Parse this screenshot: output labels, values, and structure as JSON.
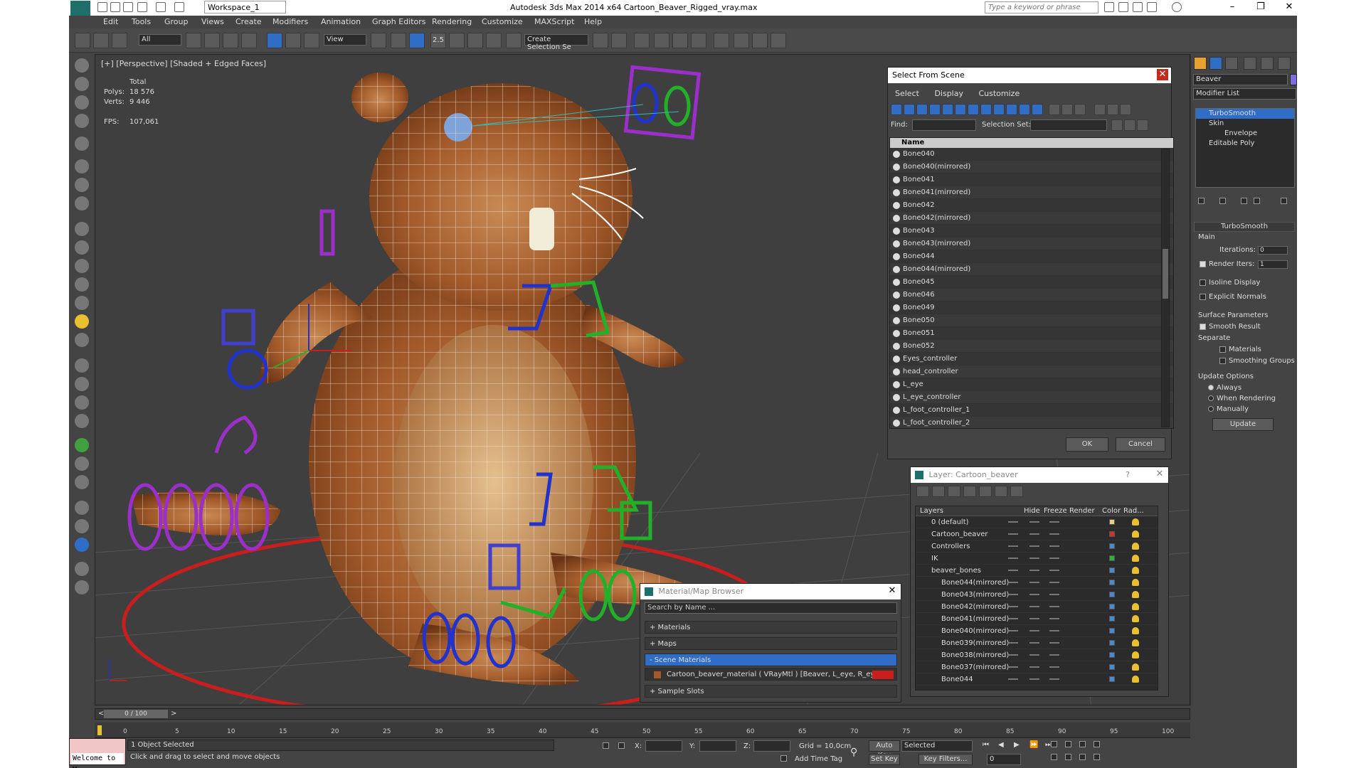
{
  "window": {
    "title": "Autodesk 3ds Max  2014 x64     Cartoon_Beaver_Rigged_vray.max",
    "workspace": "Workspace_1",
    "search_placeholder": "Type a keyword or phrase"
  },
  "menu": [
    "Edit",
    "Tools",
    "Group",
    "Views",
    "Create",
    "Modifiers",
    "Animation",
    "Graph Editors",
    "Rendering",
    "Customize",
    "MAXScript",
    "Help"
  ],
  "toolbar": {
    "filter": "All",
    "coord": "View",
    "selection_set": "Create Selection Se",
    "snap_label": "2.5"
  },
  "viewport": {
    "label": "[+] [Perspective] [Shaded + Edged Faces]",
    "stats": {
      "total_label": "Total",
      "polys_label": "Polys:",
      "polys": "18 576",
      "verts_label": "Verts:",
      "verts": "9 446",
      "fps_label": "FPS:",
      "fps": "107,061"
    }
  },
  "right_panel": {
    "object_name": "Beaver",
    "modifier_list": "Modifier List",
    "stack": [
      "TurboSmooth",
      "Skin",
      "Envelope",
      "Editable Poly"
    ],
    "turbosmooth": {
      "title": "TurboSmooth",
      "main": "Main",
      "iterations_label": "Iterations:",
      "iterations": "0",
      "render_iters_label": "Render Iters:",
      "render_iters": "1",
      "isoline": "Isoline Display",
      "explicit": "Explicit Normals",
      "surface": "Surface Parameters",
      "smooth_result": "Smooth Result",
      "separate": "Separate",
      "materials": "Materials",
      "smoothing_groups": "Smoothing Groups",
      "update_options": "Update Options",
      "always": "Always",
      "when_rendering": "When Rendering",
      "manually": "Manually",
      "update": "Update"
    }
  },
  "select_from_scene": {
    "title": "Select From Scene",
    "menu": [
      "Select",
      "Display",
      "Customize"
    ],
    "find_label": "Find:",
    "selection_set_label": "Selection Set:",
    "column": "Name",
    "items": [
      "Bone040",
      "Bone040(mirrored)",
      "Bone041",
      "Bone041(mirrored)",
      "Bone042",
      "Bone042(mirrored)",
      "Bone043",
      "Bone043(mirrored)",
      "Bone044",
      "Bone044(mirrored)",
      "Bone045",
      "Bone046",
      "Bone049",
      "Bone050",
      "Bone051",
      "Bone052",
      "Eyes_controller",
      "head_controller",
      "L_eye",
      "L_eye_controller",
      "L_foot_controller_1",
      "L_foot_controller_2"
    ],
    "ok": "OK",
    "cancel": "Cancel"
  },
  "layer_dialog": {
    "title": "Layer: Cartoon_beaver",
    "help": "?",
    "columns": [
      "Layers",
      "Hide",
      "Freeze",
      "Render",
      "Color",
      "Rad..."
    ],
    "layers": [
      {
        "name": "0 (default)",
        "color": "#e8d080",
        "indent": 1
      },
      {
        "name": "Cartoon_beaver",
        "color": "#d03030",
        "indent": 1
      },
      {
        "name": "Controllers",
        "color": "#4a8ad0",
        "indent": 1
      },
      {
        "name": "IK",
        "color": "#30b040",
        "indent": 1
      },
      {
        "name": "beaver_bones",
        "color": "#4a8ad0",
        "indent": 1
      },
      {
        "name": "Bone044(mirrored)",
        "color": "#4a8ad0",
        "indent": 2
      },
      {
        "name": "Bone043(mirrored)",
        "color": "#4a8ad0",
        "indent": 2
      },
      {
        "name": "Bone042(mirrored)",
        "color": "#4a8ad0",
        "indent": 2
      },
      {
        "name": "Bone041(mirrored)",
        "color": "#4a8ad0",
        "indent": 2
      },
      {
        "name": "Bone040(mirrored)",
        "color": "#4a8ad0",
        "indent": 2
      },
      {
        "name": "Bone039(mirrored)",
        "color": "#4a8ad0",
        "indent": 2
      },
      {
        "name": "Bone038(mirrored)",
        "color": "#4a8ad0",
        "indent": 2
      },
      {
        "name": "Bone037(mirrored)",
        "color": "#4a8ad0",
        "indent": 2
      },
      {
        "name": "Bone044",
        "color": "#4a8ad0",
        "indent": 2
      }
    ]
  },
  "material_browser": {
    "title": "Material/Map Browser",
    "search": "Search by Name ...",
    "rows": [
      "+ Materials",
      "+ Maps",
      "- Scene Materials"
    ],
    "material": "Cartoon_beaver_material  ( VRayMtl ) [Beaver, L_eye, R_eye]",
    "sample_slots": "+ Sample Slots"
  },
  "timeline": {
    "frame": "0 / 100",
    "ticks": [
      "0",
      "5",
      "10",
      "15",
      "20",
      "25",
      "30",
      "35",
      "40",
      "45",
      "50",
      "55",
      "60",
      "65",
      "70",
      "75",
      "80",
      "85",
      "90",
      "95",
      "100"
    ]
  },
  "status": {
    "selected": "1 Object Selected",
    "hint": "Click and drag to select and move objects",
    "maxscript": "Welcome to M",
    "x_label": "X:",
    "y_label": "Y:",
    "z_label": "Z:",
    "grid": "Grid = 10,0cm",
    "add_time_tag": "Add Time Tag",
    "auto_key": "Auto Key",
    "set_key": "Set Key",
    "selected_dropdown": "Selected",
    "key_filters": "Key Filters...",
    "frame_field": "0"
  },
  "colors": {
    "accent_blue": "#2f6dc6",
    "beaver_fur": "#a25a2a",
    "controller_purple": "#9b2fc9",
    "controller_red": "#c81e1e",
    "controller_green": "#22b02a"
  }
}
